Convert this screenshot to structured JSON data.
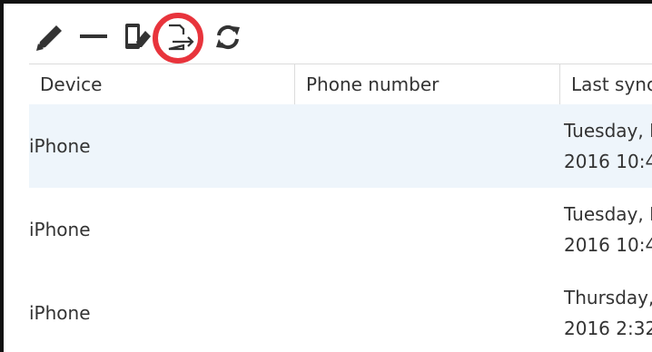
{
  "toolbar": {
    "buttons": [
      {
        "name": "pencil-icon",
        "label": "Edit"
      },
      {
        "name": "minus-icon",
        "label": "Remove"
      },
      {
        "name": "phone-eraser-icon",
        "label": "Wipe device"
      },
      {
        "name": "phone-export-icon",
        "label": "Export"
      },
      {
        "name": "refresh-icon",
        "label": "Refresh"
      }
    ],
    "highlighted": "phone-export-icon",
    "highlight_color": "#e8343c"
  },
  "table": {
    "columns": [
      "Device",
      "Phone number",
      "Last sync"
    ],
    "rows": [
      {
        "device": "iPhone",
        "phone": "",
        "sync_line1": "Tuesday, I",
        "sync_line2": "2016 10:4"
      },
      {
        "device": "iPhone",
        "phone": "",
        "sync_line1": "Tuesday, I",
        "sync_line2": "2016 10:4"
      },
      {
        "device": "iPhone",
        "phone": "",
        "sync_line1": "Thursday,",
        "sync_line2": "2016 2:32"
      }
    ],
    "selected_row": 0,
    "selected_color": "#eef5fb"
  }
}
